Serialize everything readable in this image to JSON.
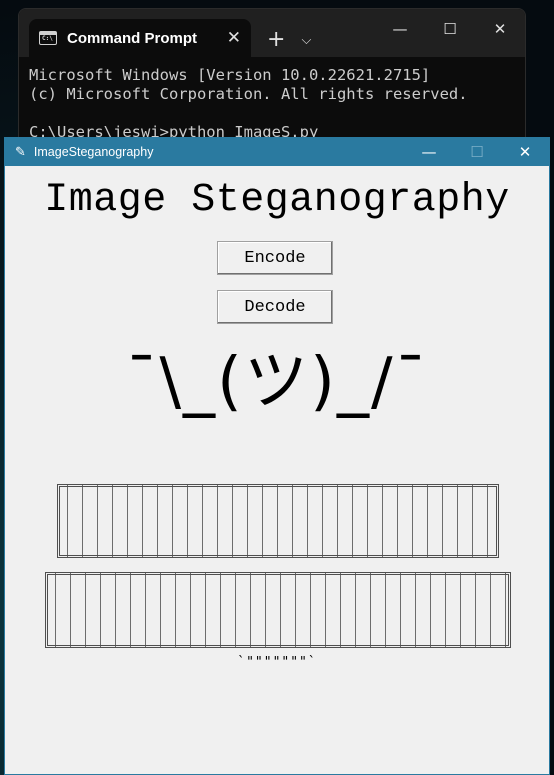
{
  "terminal": {
    "tab_title": "Command Prompt",
    "lines": [
      "Microsoft Windows [Version 10.0.22621.2715]",
      "(c) Microsoft Corporation. All rights reserved.",
      "",
      "C:\\Users\\jeswi>python ImageS.py"
    ]
  },
  "app": {
    "window_title": "ImageSteganography",
    "heading": "Image Steganography",
    "encode_label": "Encode",
    "decode_label": "Decode",
    "shrug": "¯\\_(ツ)_/¯",
    "ascii_row1": "╔══╗╔════╗╔══╗╔══╗╔══╗╔═╗╔══╗╔═══╗",
    "ascii_row2": "║╔╗║╚╗╔╗╔╝║╔╗║║╔╗║║╔═╝║║║║╔═╝║╔═╗║",
    "footer_quote": "`\"\"\"\"\"\"\"`"
  },
  "colors": {
    "app_titlebar": "#2a7aa0",
    "terminal_bg": "#0c0c0c"
  }
}
